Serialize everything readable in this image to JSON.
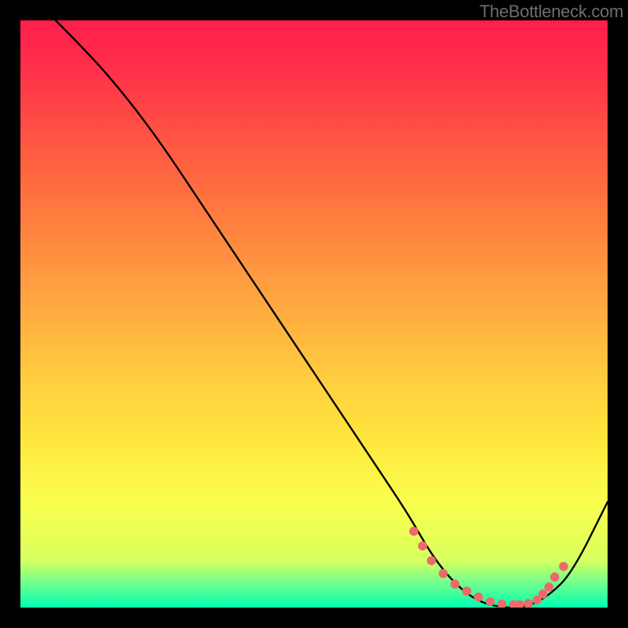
{
  "watermark": "TheBottleneck.com",
  "chart_data": {
    "type": "line",
    "title": "",
    "xlabel": "",
    "ylabel": "",
    "xlim": [
      0,
      100
    ],
    "ylim": [
      0,
      100
    ],
    "series": [
      {
        "name": "bottleneck-curve",
        "x": [
          6,
          12,
          18,
          24,
          30,
          36,
          42,
          48,
          54,
          60,
          66,
          70,
          74,
          78,
          82,
          86,
          90,
          94,
          100
        ],
        "y": [
          100,
          94,
          87,
          79,
          70,
          61,
          52,
          43,
          34,
          25,
          16,
          9,
          4,
          1,
          0,
          0,
          2,
          6,
          18
        ]
      }
    ],
    "markers": {
      "name": "valley-dots",
      "color": "#ec6a6a",
      "x": [
        67,
        68.5,
        70,
        72,
        74,
        76,
        78,
        80,
        82,
        84,
        85,
        86.5,
        88,
        89,
        90,
        91,
        92.5
      ],
      "y": [
        13,
        10.5,
        8,
        5.8,
        4,
        2.8,
        1.8,
        1,
        0.6,
        0.5,
        0.5,
        0.7,
        1.3,
        2.3,
        3.5,
        5.2,
        7
      ]
    }
  }
}
